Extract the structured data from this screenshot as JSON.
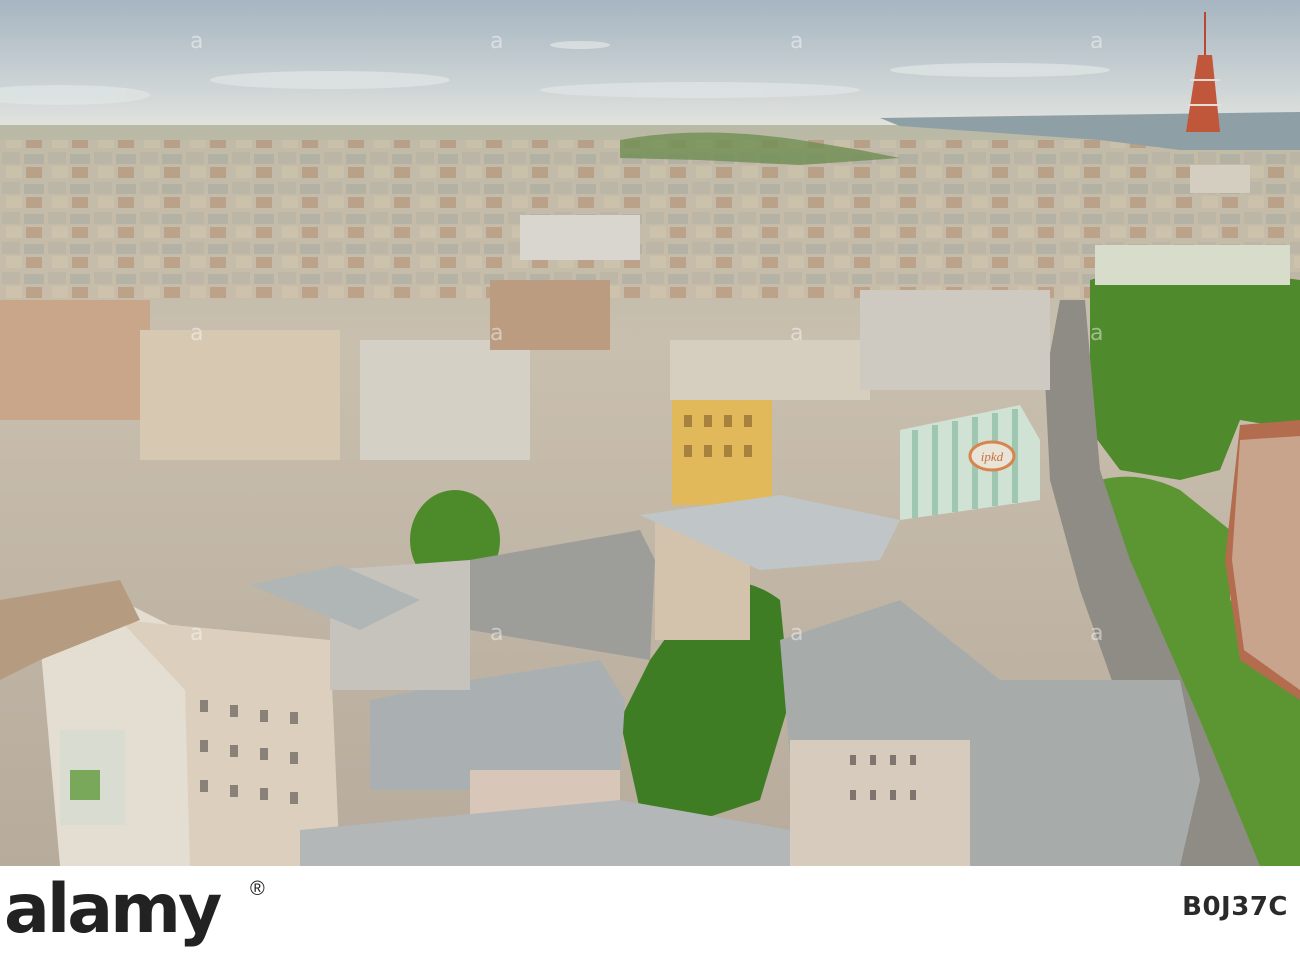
{
  "scene": {
    "sign_text": "ipkd"
  },
  "footer": {
    "brand": "alamy",
    "image_id": "B0J37C"
  },
  "colors": {
    "sky_top": "#a9b8c3",
    "sky_horizon": "#dfe3df",
    "river": "#8e9fa6",
    "tree_green": "#4f8a2c",
    "tower": "#b9482c"
  },
  "icons": {
    "watermark": "alamy-watermark-icon"
  }
}
